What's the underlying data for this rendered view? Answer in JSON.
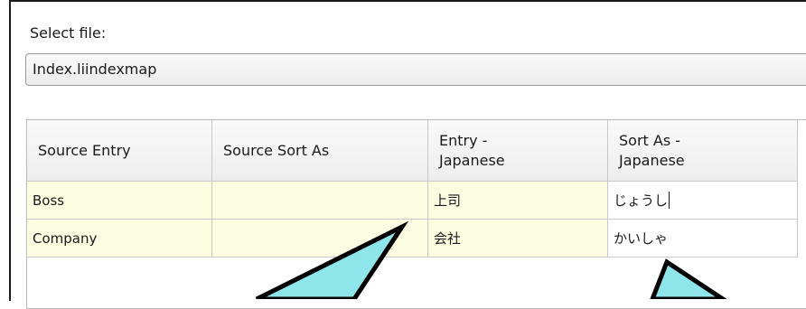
{
  "select_file": {
    "label": "Select file:",
    "value": "Index.liindexmap"
  },
  "table": {
    "headers": [
      "Source Entry",
      "Source Sort As",
      "Entry -\nJapanese",
      "Sort As -\nJapanese"
    ],
    "rows": [
      [
        "Boss",
        "",
        "上司",
        "じょうし"
      ],
      [
        "Company",
        "",
        "会社",
        "かいしゃ"
      ]
    ]
  },
  "colors": {
    "callout_fill": "#8ee6ea",
    "callout_stroke": "#000000",
    "row_highlight": "#fdfde2"
  }
}
